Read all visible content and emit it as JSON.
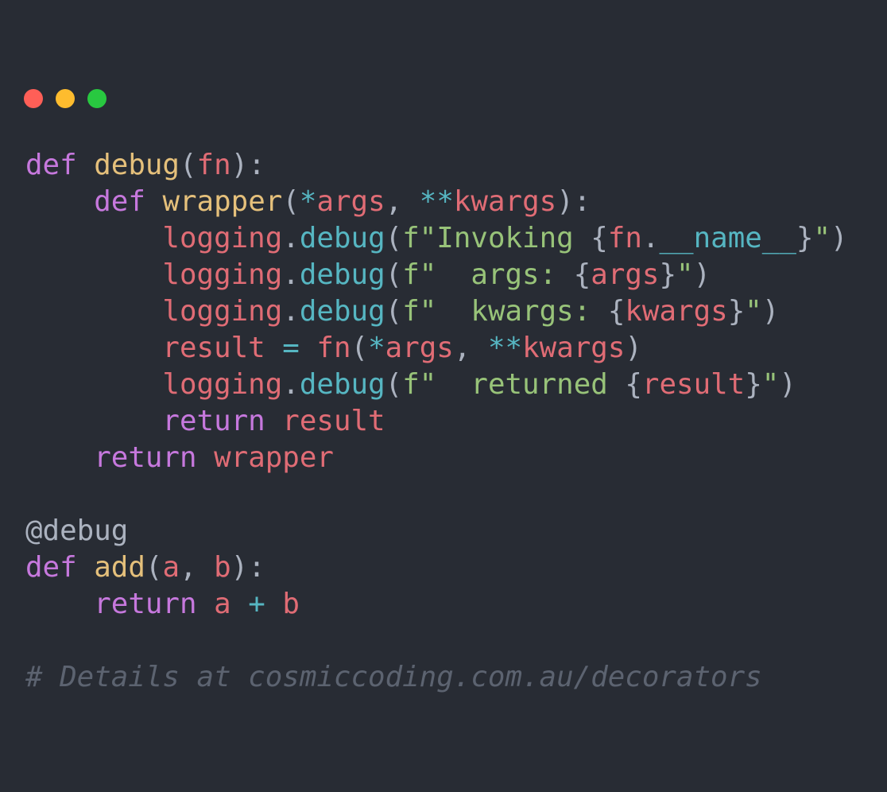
{
  "window": {
    "controls": [
      {
        "name": "close",
        "color": "#ff5f57"
      },
      {
        "name": "minimize",
        "color": "#febc2e"
      },
      {
        "name": "zoom",
        "color": "#28c840"
      }
    ]
  },
  "code": {
    "lines": [
      [
        {
          "t": "def",
          "k": "kw"
        },
        {
          "t": " ",
          "k": "punc"
        },
        {
          "t": "debug",
          "k": "fnname"
        },
        {
          "t": "(",
          "k": "punc"
        },
        {
          "t": "fn",
          "k": "param"
        },
        {
          "t": "):",
          "k": "punc"
        }
      ],
      [
        {
          "t": "    ",
          "k": "punc"
        },
        {
          "t": "def",
          "k": "kw"
        },
        {
          "t": " ",
          "k": "punc"
        },
        {
          "t": "wrapper",
          "k": "fnname"
        },
        {
          "t": "(",
          "k": "punc"
        },
        {
          "t": "*",
          "k": "op"
        },
        {
          "t": "args",
          "k": "param"
        },
        {
          "t": ", ",
          "k": "punc"
        },
        {
          "t": "**",
          "k": "op"
        },
        {
          "t": "kwargs",
          "k": "param"
        },
        {
          "t": "):",
          "k": "punc"
        }
      ],
      [
        {
          "t": "        ",
          "k": "punc"
        },
        {
          "t": "logging",
          "k": "var"
        },
        {
          "t": ".",
          "k": "punc"
        },
        {
          "t": "debug",
          "k": "meth"
        },
        {
          "t": "(",
          "k": "punc"
        },
        {
          "t": "f\"Invoking ",
          "k": "str"
        },
        {
          "t": "{",
          "k": "punc"
        },
        {
          "t": "fn",
          "k": "var"
        },
        {
          "t": ".",
          "k": "punc"
        },
        {
          "t": "__name__",
          "k": "meth"
        },
        {
          "t": "}",
          "k": "punc"
        },
        {
          "t": "\"",
          "k": "str"
        },
        {
          "t": ")",
          "k": "punc"
        }
      ],
      [
        {
          "t": "        ",
          "k": "punc"
        },
        {
          "t": "logging",
          "k": "var"
        },
        {
          "t": ".",
          "k": "punc"
        },
        {
          "t": "debug",
          "k": "meth"
        },
        {
          "t": "(",
          "k": "punc"
        },
        {
          "t": "f\"  args: ",
          "k": "str"
        },
        {
          "t": "{",
          "k": "punc"
        },
        {
          "t": "args",
          "k": "var"
        },
        {
          "t": "}",
          "k": "punc"
        },
        {
          "t": "\"",
          "k": "str"
        },
        {
          "t": ")",
          "k": "punc"
        }
      ],
      [
        {
          "t": "        ",
          "k": "punc"
        },
        {
          "t": "logging",
          "k": "var"
        },
        {
          "t": ".",
          "k": "punc"
        },
        {
          "t": "debug",
          "k": "meth"
        },
        {
          "t": "(",
          "k": "punc"
        },
        {
          "t": "f\"  kwargs: ",
          "k": "str"
        },
        {
          "t": "{",
          "k": "punc"
        },
        {
          "t": "kwargs",
          "k": "var"
        },
        {
          "t": "}",
          "k": "punc"
        },
        {
          "t": "\"",
          "k": "str"
        },
        {
          "t": ")",
          "k": "punc"
        }
      ],
      [
        {
          "t": "        ",
          "k": "punc"
        },
        {
          "t": "result",
          "k": "var"
        },
        {
          "t": " ",
          "k": "punc"
        },
        {
          "t": "=",
          "k": "op"
        },
        {
          "t": " ",
          "k": "punc"
        },
        {
          "t": "fn",
          "k": "var"
        },
        {
          "t": "(",
          "k": "punc"
        },
        {
          "t": "*",
          "k": "op"
        },
        {
          "t": "args",
          "k": "var"
        },
        {
          "t": ", ",
          "k": "punc"
        },
        {
          "t": "**",
          "k": "op"
        },
        {
          "t": "kwargs",
          "k": "var"
        },
        {
          "t": ")",
          "k": "punc"
        }
      ],
      [
        {
          "t": "        ",
          "k": "punc"
        },
        {
          "t": "logging",
          "k": "var"
        },
        {
          "t": ".",
          "k": "punc"
        },
        {
          "t": "debug",
          "k": "meth"
        },
        {
          "t": "(",
          "k": "punc"
        },
        {
          "t": "f\"  returned ",
          "k": "str"
        },
        {
          "t": "{",
          "k": "punc"
        },
        {
          "t": "result",
          "k": "var"
        },
        {
          "t": "}",
          "k": "punc"
        },
        {
          "t": "\"",
          "k": "str"
        },
        {
          "t": ")",
          "k": "punc"
        }
      ],
      [
        {
          "t": "        ",
          "k": "punc"
        },
        {
          "t": "return",
          "k": "kw"
        },
        {
          "t": " ",
          "k": "punc"
        },
        {
          "t": "result",
          "k": "var"
        }
      ],
      [
        {
          "t": "    ",
          "k": "punc"
        },
        {
          "t": "return",
          "k": "kw"
        },
        {
          "t": " ",
          "k": "punc"
        },
        {
          "t": "wrapper",
          "k": "var"
        }
      ],
      [],
      [
        {
          "t": "@debug",
          "k": "deco"
        }
      ],
      [
        {
          "t": "def",
          "k": "kw"
        },
        {
          "t": " ",
          "k": "punc"
        },
        {
          "t": "add",
          "k": "fnname"
        },
        {
          "t": "(",
          "k": "punc"
        },
        {
          "t": "a",
          "k": "param"
        },
        {
          "t": ", ",
          "k": "punc"
        },
        {
          "t": "b",
          "k": "param"
        },
        {
          "t": "):",
          "k": "punc"
        }
      ],
      [
        {
          "t": "    ",
          "k": "punc"
        },
        {
          "t": "return",
          "k": "kw"
        },
        {
          "t": " ",
          "k": "punc"
        },
        {
          "t": "a",
          "k": "var"
        },
        {
          "t": " ",
          "k": "punc"
        },
        {
          "t": "+",
          "k": "op"
        },
        {
          "t": " ",
          "k": "punc"
        },
        {
          "t": "b",
          "k": "var"
        }
      ],
      [],
      [
        {
          "t": "# Details at cosmiccoding.com.au/decorators",
          "k": "comment"
        }
      ]
    ]
  }
}
